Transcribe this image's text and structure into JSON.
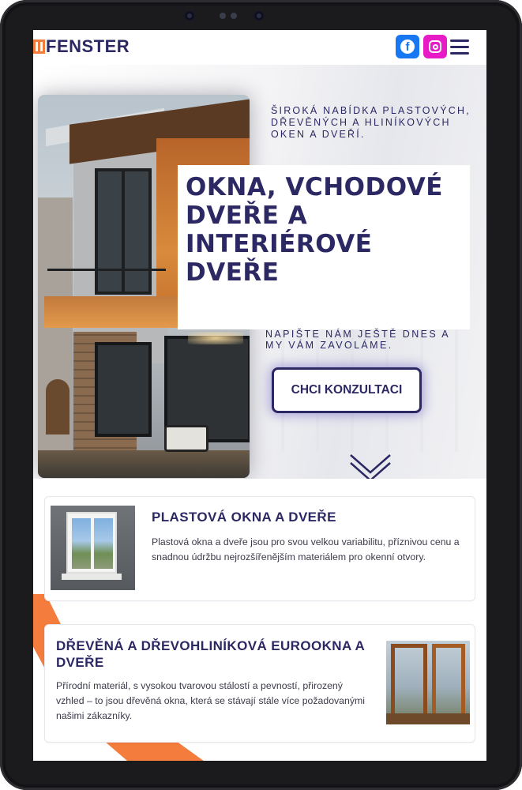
{
  "header": {
    "logo_text": "FENSTER",
    "social": {
      "facebook_glyph": "f"
    }
  },
  "hero": {
    "tagline": "Široká nabídka plastových, dřevěných a hliníkových oken a dveří.",
    "headline": "Okna, vchodové dveře a interiérové dveře",
    "callout": "Napište nám ještě dnes a my vám zavoláme.",
    "cta_label": "CHCI KONZULTACI"
  },
  "cards": [
    {
      "title": "PLASTOVÁ OKNA A DVEŘE",
      "text": "Plastová okna a dveře jsou pro svou velkou variabilitu, příznivou cenu a snadnou údržbu nejrozšířenějším materiálem pro okenní otvory."
    },
    {
      "title": "DŘEVĚNÁ A DŘEVOHLINÍKOVÁ EUROOKNA A DVEŘE",
      "text": "Přírodní materiál, s vysokou tvarovou stálostí a pevností, přirozený vzhled – to jsou dřevěná okna, která se stávají stále více požadovanými našimi zákazníky."
    }
  ],
  "colors": {
    "brand_navy": "#2c2863",
    "accent_orange": "#f47c3c",
    "facebook_blue": "#1877f2",
    "instagram_pink": "#e81cc7"
  },
  "icons": [
    "facebook-icon",
    "instagram-icon",
    "hamburger-menu-icon",
    "chevron-down-icon"
  ]
}
